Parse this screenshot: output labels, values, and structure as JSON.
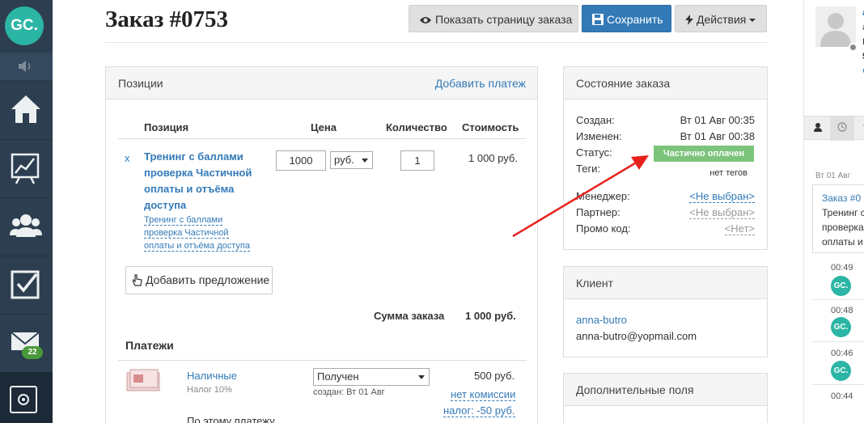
{
  "sidebar": {
    "logo": "GC.",
    "mail_badge": "22"
  },
  "page": {
    "title": "Заказ #0753"
  },
  "toolbar": {
    "show_order": "Показать страницу заказа",
    "save": "Сохранить",
    "actions": "Действия"
  },
  "positions": {
    "header": "Позиции",
    "add_payment": "Добавить платеж",
    "columns": {
      "item": "Позиция",
      "price": "Цена",
      "quantity": "Количество",
      "cost": "Стоимость"
    },
    "row": {
      "remove": "x",
      "name_line1": "Тренинг с баллами",
      "name_line2": "проверка Частичной",
      "name_line3": "оплаты и отъёма",
      "name_line4": "доступа",
      "offer_line1": "Тренинг с баллами",
      "offer_line2": "проверка Частичной",
      "offer_line3": "оплаты и отъёма доступа",
      "price": "1000",
      "currency": "руб.",
      "quantity": "1",
      "cost": "1 000 руб."
    },
    "add_offer": "Добавить предложение",
    "total_label": "Сумма заказа",
    "total_value": "1 000 руб."
  },
  "payments": {
    "header": "Платежи",
    "row": {
      "method": "Наличные",
      "tax": "Налог 10%",
      "status": "Получен",
      "created": "создан: Вт 01 Авг",
      "amount": "500 руб.",
      "commission": "нет комиссии",
      "tax_amount": "налог: -50 руб.",
      "note": "По этому платежу"
    }
  },
  "order_state": {
    "header": "Состояние заказа",
    "created_label": "Создан:",
    "created_value": "Вт 01 Авг 00:35",
    "changed_label": "Изменен:",
    "changed_value": "Вт 01 Авг 00:38",
    "status_label": "Статус:",
    "status_value": "Частично оплачен",
    "status_color": "#7cc47c",
    "tags_label": "Теги:",
    "tags_value": "нет тегов",
    "manager_label": "Менеджер:",
    "manager_value": "<Не выбран>",
    "partner_label": "Партнер:",
    "partner_value": "<Не выбран>",
    "promo_label": "Промо код:",
    "promo_value": "<Нет>"
  },
  "client": {
    "header": "Клиент",
    "name": "anna-butro",
    "email": "anna-butro@yopmail.com"
  },
  "extra_fields": {
    "header": "Дополнительные поля"
  },
  "activity": {
    "frag_a": "a",
    "frag_b": "a",
    "frag_c": "Б",
    "frag_d": "5",
    "frag_e": "¢",
    "tab_3": "Y",
    "date": "Вт 01 Авг",
    "card_link": "Заказ #0",
    "card_line1": "Тренинг с",
    "card_line2": "проверка",
    "card_line3": "оплаты и",
    "events": [
      {
        "time": "00:49",
        "avatar": "GC."
      },
      {
        "time": "00:48",
        "avatar": "GC."
      },
      {
        "time": "00:46",
        "avatar": "GC."
      },
      {
        "time": "00:44"
      }
    ]
  },
  "colors": {
    "sidebar": "#2c3e50",
    "brand": "#2bb5a4",
    "primary": "#337ab7",
    "arrow": "#e8201b"
  }
}
